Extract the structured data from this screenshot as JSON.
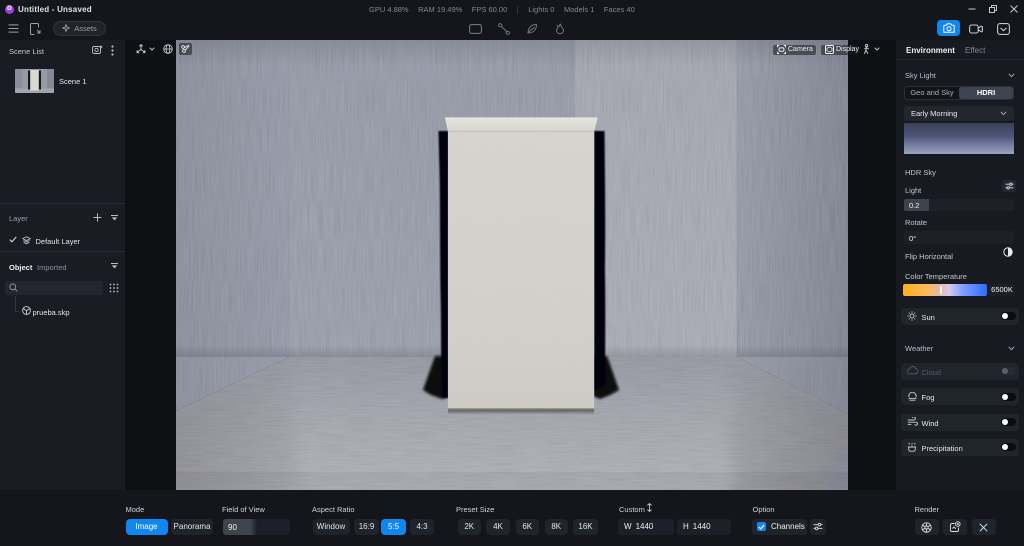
{
  "titlebar": {
    "title": "Untitled - Unsaved",
    "stats": {
      "gpu": "GPU 4.88%",
      "ram": "RAM 19.49%",
      "fps": "FPS 60.00",
      "sep": "|",
      "lights": "Lights 0",
      "models": "Models 1",
      "faces": "Faces 40"
    }
  },
  "toolbar": {
    "assets_label": "Assets"
  },
  "scene_panel": {
    "header": "Scene List",
    "scene_name": "Scene 1"
  },
  "layer_panel": {
    "header": "Layer",
    "default_layer": "Default Layer"
  },
  "object_panel": {
    "header": "Object",
    "filter": "Imported",
    "item": "prueba.skp"
  },
  "viewport_overlay": {
    "camera_label": "Camera",
    "display_label": "Display"
  },
  "env_panel": {
    "tabs": {
      "environment": "Environment",
      "effect": "Effect"
    },
    "sky_light": {
      "header": "Sky Light",
      "geo_and_sky": "Geo and Sky",
      "hdri": "HDRI",
      "selected_mode": "HDRI",
      "preset": "Early Morning",
      "hdr_sky_label": "HDR Sky",
      "light_label": "Light",
      "light_value": "0.2",
      "light_fill": 0.23,
      "rotate_label": "Rotate",
      "rotate_value": "0°",
      "rotate_fill": 0,
      "flip_label": "Flip Horizontal",
      "color_temp_label": "Color Temperature",
      "color_temp_value": "6500K",
      "color_temp_pos": 0.45,
      "sun_label": "Sun",
      "sun_toggle": "off"
    },
    "weather": {
      "header": "Weather",
      "cloud": "Cloud",
      "cloud_toggle": "off",
      "cloud_disabled": true,
      "fog": "Fog",
      "fog_toggle": "off",
      "wind": "Wind",
      "wind_toggle": "off",
      "precipitation": "Precipitation",
      "precipitation_toggle": "off"
    }
  },
  "bottombar": {
    "mode": {
      "label": "Mode",
      "image": "Image",
      "panorama": "Panorama",
      "selected": "Image"
    },
    "fov": {
      "label": "Field of View",
      "value": "90",
      "fill": 0.5
    },
    "aspect": {
      "label": "Aspect Ratio",
      "options": [
        "Window",
        "16:9",
        "5:5",
        "4:3"
      ],
      "selected": "5:5"
    },
    "preset": {
      "label": "Preset Size",
      "options": [
        "2K",
        "4K",
        "6K",
        "8K",
        "16K"
      ]
    },
    "custom": {
      "label": "Custom",
      "w_prefix": "W",
      "w_value": "1440",
      "h_prefix": "H",
      "h_value": "1440"
    },
    "option": {
      "label": "Option",
      "channels": "Channels",
      "channels_checked": true
    },
    "render": {
      "label": "Render"
    }
  },
  "colors": {
    "accent": "#1086f0",
    "panel_bg": "#171a21",
    "bar_bg": "#14161c"
  },
  "icons": [
    "app-logo",
    "hamburger-icon",
    "import-file-icon",
    "sparkle-icon",
    "rect-tool-icon",
    "line-tool-icon",
    "leaf-tool-icon",
    "flame-tool-icon",
    "photo-camera-icon",
    "video-camera-icon",
    "render-queue-icon",
    "minimize-icon",
    "restore-icon",
    "close-icon",
    "add-scene-icon",
    "kebab-icon",
    "plus-icon",
    "collapse-icon",
    "check-icon",
    "layer-stack-icon",
    "search-icon",
    "grid-dots-icon",
    "cube-icon",
    "gizmo-icon",
    "globe-icon",
    "chevron-down-icon",
    "scissors-icon",
    "camera-frame-icon",
    "display-cube-icon",
    "walk-person-icon",
    "equalizer-icon",
    "half-circle-icon",
    "sun-icon",
    "cloud-icon",
    "fog-icon",
    "wind-icon",
    "precipitation-icon",
    "updown-arrows-icon",
    "aperture-icon",
    "render-save-icon",
    "x-icon",
    "checkmark-icon"
  ]
}
